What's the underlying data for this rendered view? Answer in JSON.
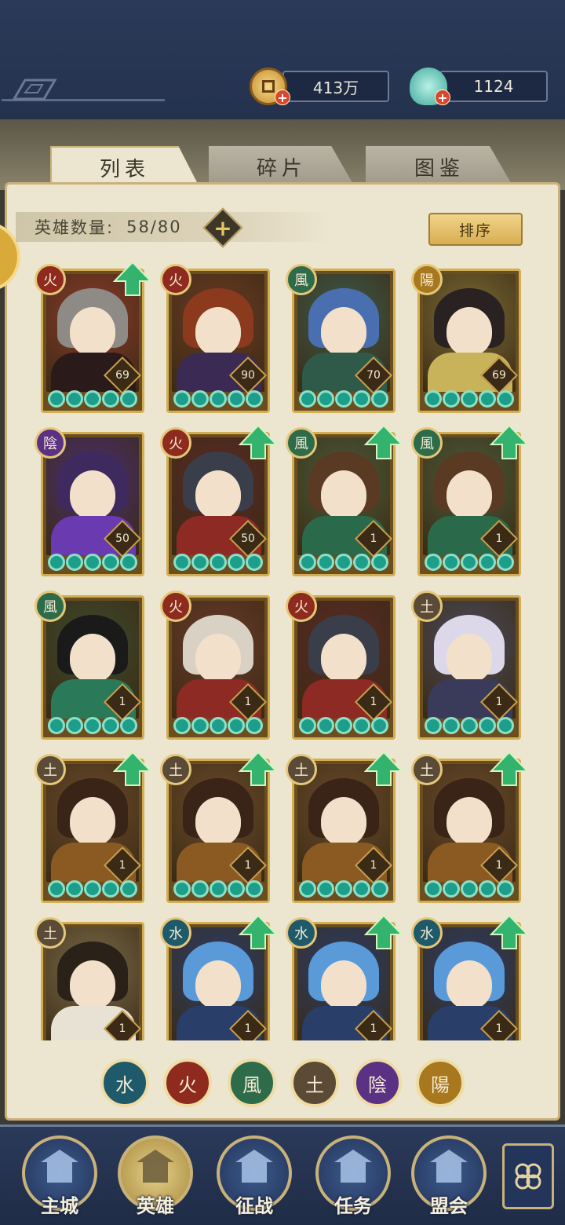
{
  "currency": {
    "coins": "413万",
    "jade": "1124"
  },
  "tabs": [
    {
      "label": "列表",
      "active": true
    },
    {
      "label": "碎片",
      "active": false
    },
    {
      "label": "图鉴",
      "active": false
    }
  ],
  "hero_count": {
    "label": "英雄数量:",
    "value": "58/80"
  },
  "sort_label": "排序",
  "elements": {
    "fire": {
      "glyph": "火",
      "color": "#8e2a1e"
    },
    "wind": {
      "glyph": "風",
      "color": "#2d6b4a"
    },
    "earth": {
      "glyph": "土",
      "color": "#5b4a36"
    },
    "yin": {
      "glyph": "陰",
      "color": "#5b3283"
    },
    "yang": {
      "glyph": "陽",
      "color": "#a8781f"
    },
    "water": {
      "glyph": "水",
      "color": "#1f5a6b"
    }
  },
  "heroes": [
    {
      "element": "fire",
      "glyph": "火",
      "level": "69",
      "upgrade": true,
      "art": "#8a3a2a",
      "hair": "#8e8a86",
      "body": "#2b1a1a"
    },
    {
      "element": "fire",
      "glyph": "火",
      "level": "90",
      "upgrade": false,
      "art": "#6a3a22",
      "hair": "#8b3a1e",
      "body": "#3b2b54"
    },
    {
      "element": "wind",
      "glyph": "風",
      "level": "70",
      "upgrade": false,
      "art": "#3e5a4a",
      "hair": "#4a6fb0",
      "body": "#2f5a4a"
    },
    {
      "element": "yang",
      "glyph": "陽",
      "level": "69",
      "upgrade": false,
      "art": "#7a6a34",
      "hair": "#2a2222",
      "body": "#c9b35a"
    },
    {
      "element": "yin",
      "glyph": "陰",
      "level": "50",
      "upgrade": false,
      "art": "#4a2e6e",
      "hair": "#3e2a5e",
      "body": "#6a3ab0"
    },
    {
      "element": "fire",
      "glyph": "火",
      "level": "50",
      "upgrade": true,
      "art": "#5a2a26",
      "hair": "#3a3e4a",
      "body": "#8e2a24"
    },
    {
      "element": "wind",
      "glyph": "風",
      "level": "1",
      "upgrade": true,
      "art": "#4a5a3a",
      "hair": "#5a3a22",
      "body": "#2a6a4a"
    },
    {
      "element": "wind",
      "glyph": "風",
      "level": "1",
      "upgrade": true,
      "art": "#4a5a3a",
      "hair": "#5a3a22",
      "body": "#2a6a4a"
    },
    {
      "element": "wind",
      "glyph": "風",
      "level": "1",
      "upgrade": false,
      "art": "#3e4a2e",
      "hair": "#1a1a1a",
      "body": "#2a7a5a"
    },
    {
      "element": "fire",
      "glyph": "火",
      "level": "1",
      "upgrade": false,
      "art": "#6a3a2a",
      "hair": "#d9d2c4",
      "body": "#8e2a24"
    },
    {
      "element": "fire",
      "glyph": "火",
      "level": "1",
      "upgrade": false,
      "art": "#5a2a26",
      "hair": "#3a3e4a",
      "body": "#8e2a24"
    },
    {
      "element": "earth",
      "glyph": "土",
      "level": "1",
      "upgrade": false,
      "art": "#4a4a5a",
      "hair": "#dcd8ea",
      "body": "#3a3a5a"
    },
    {
      "element": "earth",
      "glyph": "土",
      "level": "1",
      "upgrade": true,
      "art": "#6a4a2a",
      "hair": "#3a2418",
      "body": "#8a5a22"
    },
    {
      "element": "earth",
      "glyph": "土",
      "level": "1",
      "upgrade": true,
      "art": "#6a4a2a",
      "hair": "#3a2418",
      "body": "#8a5a22"
    },
    {
      "element": "earth",
      "glyph": "土",
      "level": "1",
      "upgrade": true,
      "art": "#6a4a2a",
      "hair": "#3a2418",
      "body": "#8a5a22"
    },
    {
      "element": "earth",
      "glyph": "土",
      "level": "1",
      "upgrade": true,
      "art": "#6a4a2a",
      "hair": "#3a2418",
      "body": "#8a5a22"
    },
    {
      "element": "earth",
      "glyph": "土",
      "level": "1",
      "upgrade": false,
      "art": "#7a6a4a",
      "hair": "#2a2218",
      "body": "#e8e2d4"
    },
    {
      "element": "water",
      "glyph": "水",
      "level": "1",
      "upgrade": true,
      "art": "#2a3e6a",
      "hair": "#5a9ad8",
      "body": "#2a3e6a"
    },
    {
      "element": "water",
      "glyph": "水",
      "level": "1",
      "upgrade": true,
      "art": "#2a3e6a",
      "hair": "#5a9ad8",
      "body": "#2a3e6a"
    },
    {
      "element": "water",
      "glyph": "水",
      "level": "1",
      "upgrade": true,
      "art": "#2a3e6a",
      "hair": "#5a9ad8",
      "body": "#2a3e6a"
    }
  ],
  "filters": [
    {
      "glyph": "水",
      "color": "#1f5a6b"
    },
    {
      "glyph": "火",
      "color": "#8e2a1e"
    },
    {
      "glyph": "風",
      "color": "#2d6b4a"
    },
    {
      "glyph": "土",
      "color": "#5b4a36"
    },
    {
      "glyph": "陰",
      "color": "#5b3283"
    },
    {
      "glyph": "陽",
      "color": "#a8781f"
    }
  ],
  "nav": [
    {
      "label": "主城",
      "icon": "palace-icon",
      "active": false
    },
    {
      "label": "英雄",
      "icon": "hero-icon",
      "active": true
    },
    {
      "label": "征战",
      "icon": "battle-icon",
      "active": false
    },
    {
      "label": "任务",
      "icon": "scroll-icon",
      "active": false
    },
    {
      "label": "盟会",
      "icon": "guild-icon",
      "active": false
    }
  ],
  "menu_icon": "menu-icon"
}
